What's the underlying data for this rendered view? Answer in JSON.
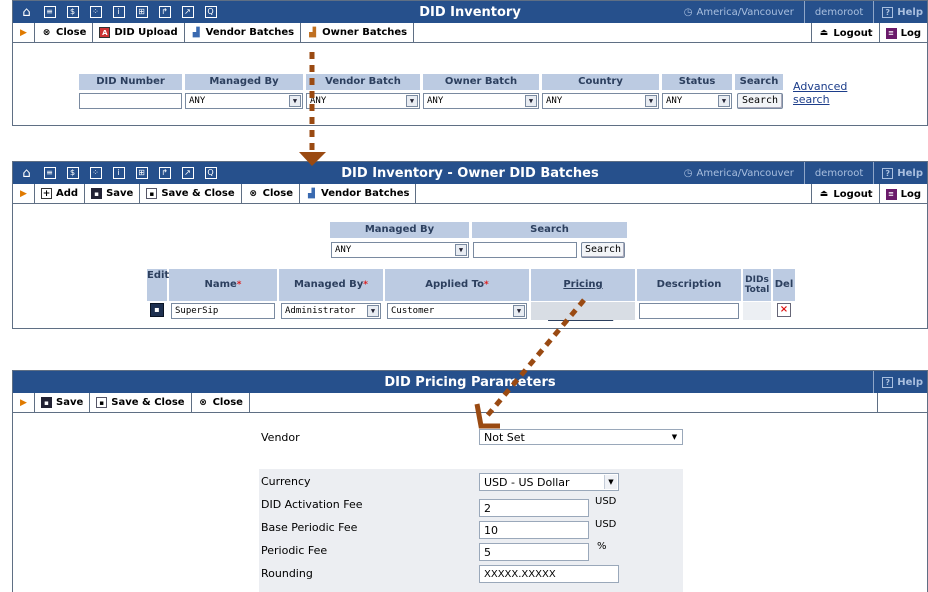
{
  "nav_icons": [
    {
      "name": "home-icon",
      "glyph": "⌂"
    },
    {
      "name": "list-icon",
      "glyph": "≡"
    },
    {
      "name": "dollar-icon",
      "glyph": "$"
    },
    {
      "name": "grid-icon",
      "glyph": "⁘"
    },
    {
      "name": "person-icon",
      "glyph": "i"
    },
    {
      "name": "network-icon",
      "glyph": "⊞"
    },
    {
      "name": "phone-icon",
      "glyph": "↱"
    },
    {
      "name": "chart-icon",
      "glyph": "↗"
    },
    {
      "name": "search-icon",
      "glyph": "Q"
    }
  ],
  "colors": {
    "titlebar": "#26508c",
    "header_cell": "#bccbe2",
    "arrow": "#9a4a12",
    "toolbar_arrow": "#e07a00"
  },
  "common": {
    "timezone": "America/Vancouver",
    "user": "demoroot",
    "help": "Help",
    "logout": "Logout",
    "log": "Log"
  },
  "panel1": {
    "title": "DID Inventory",
    "toolbar": [
      "Close",
      "DID Upload",
      "Vendor Batches",
      "Owner Batches"
    ],
    "filter_headers": [
      "DID Number",
      "Managed By",
      "Vendor Batch",
      "Owner Batch",
      "Country",
      "Status",
      "Search"
    ],
    "filter_values": {
      "did_number": "",
      "managed_by": "ANY",
      "vendor_batch": "ANY",
      "owner_batch": "ANY",
      "country": "ANY",
      "status": "ANY"
    },
    "search_button": "Search",
    "advanced_search_line1": "Advanced",
    "advanced_search_line2": "search"
  },
  "panel2": {
    "title": "DID Inventory - Owner DID Batches",
    "toolbar": [
      "Add",
      "Save",
      "Save & Close",
      "Close",
      "Vendor Batches"
    ],
    "filter_headers": [
      "Managed By",
      "Search"
    ],
    "filter_values": {
      "managed_by": "ANY",
      "search": ""
    },
    "search_button": "Search",
    "table_headers": {
      "edit": "Edit",
      "name": "Name",
      "managed_by": "Managed By",
      "applied_to": "Applied To",
      "pricing": "Pricing Parameters",
      "description": "Description",
      "dids_total_1": "DIDs",
      "dids_total_2": "Total",
      "del": "Del"
    },
    "row": {
      "name": "SuperSip",
      "managed_by": "Administrator",
      "applied_to": "Customer",
      "description": ""
    }
  },
  "panel3": {
    "title": "DID Pricing Parameters",
    "toolbar": [
      "Save",
      "Save & Close",
      "Close"
    ],
    "vendor_label": "Vendor",
    "vendor_value": "Not Set",
    "fields": {
      "currency": {
        "label": "Currency",
        "value": "USD - US Dollar"
      },
      "activation": {
        "label": "DID Activation Fee",
        "value": "2",
        "unit": "USD"
      },
      "base_periodic": {
        "label": "Base Periodic Fee",
        "value": "10",
        "unit": "USD"
      },
      "periodic": {
        "label": "Periodic Fee",
        "value": "5",
        "unit": "%"
      },
      "rounding": {
        "label": "Rounding",
        "value": "XXXXX.XXXXX"
      }
    }
  }
}
